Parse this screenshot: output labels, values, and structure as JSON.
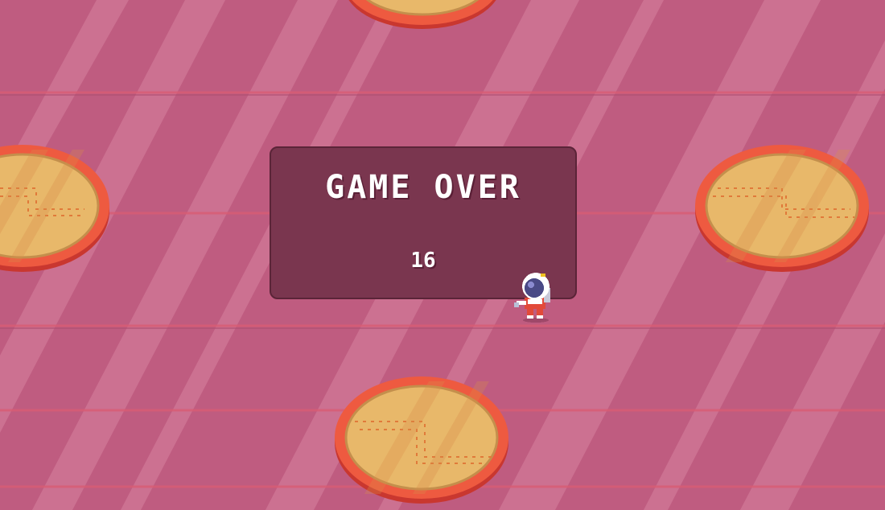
{
  "game": {
    "game_over_title": "GAME OVER",
    "score": "16"
  },
  "sprites": {
    "player": "astronaut-player",
    "platforms": [
      "platform-top",
      "platform-left",
      "platform-right",
      "platform-bottom"
    ]
  },
  "colors": {
    "background": "#bf5c80",
    "panel": "#7a364f",
    "platform_rim": "#ee5a40",
    "platform_face": "#e8b86a",
    "stripe": "#d67a9c",
    "line": "#d95d74"
  }
}
